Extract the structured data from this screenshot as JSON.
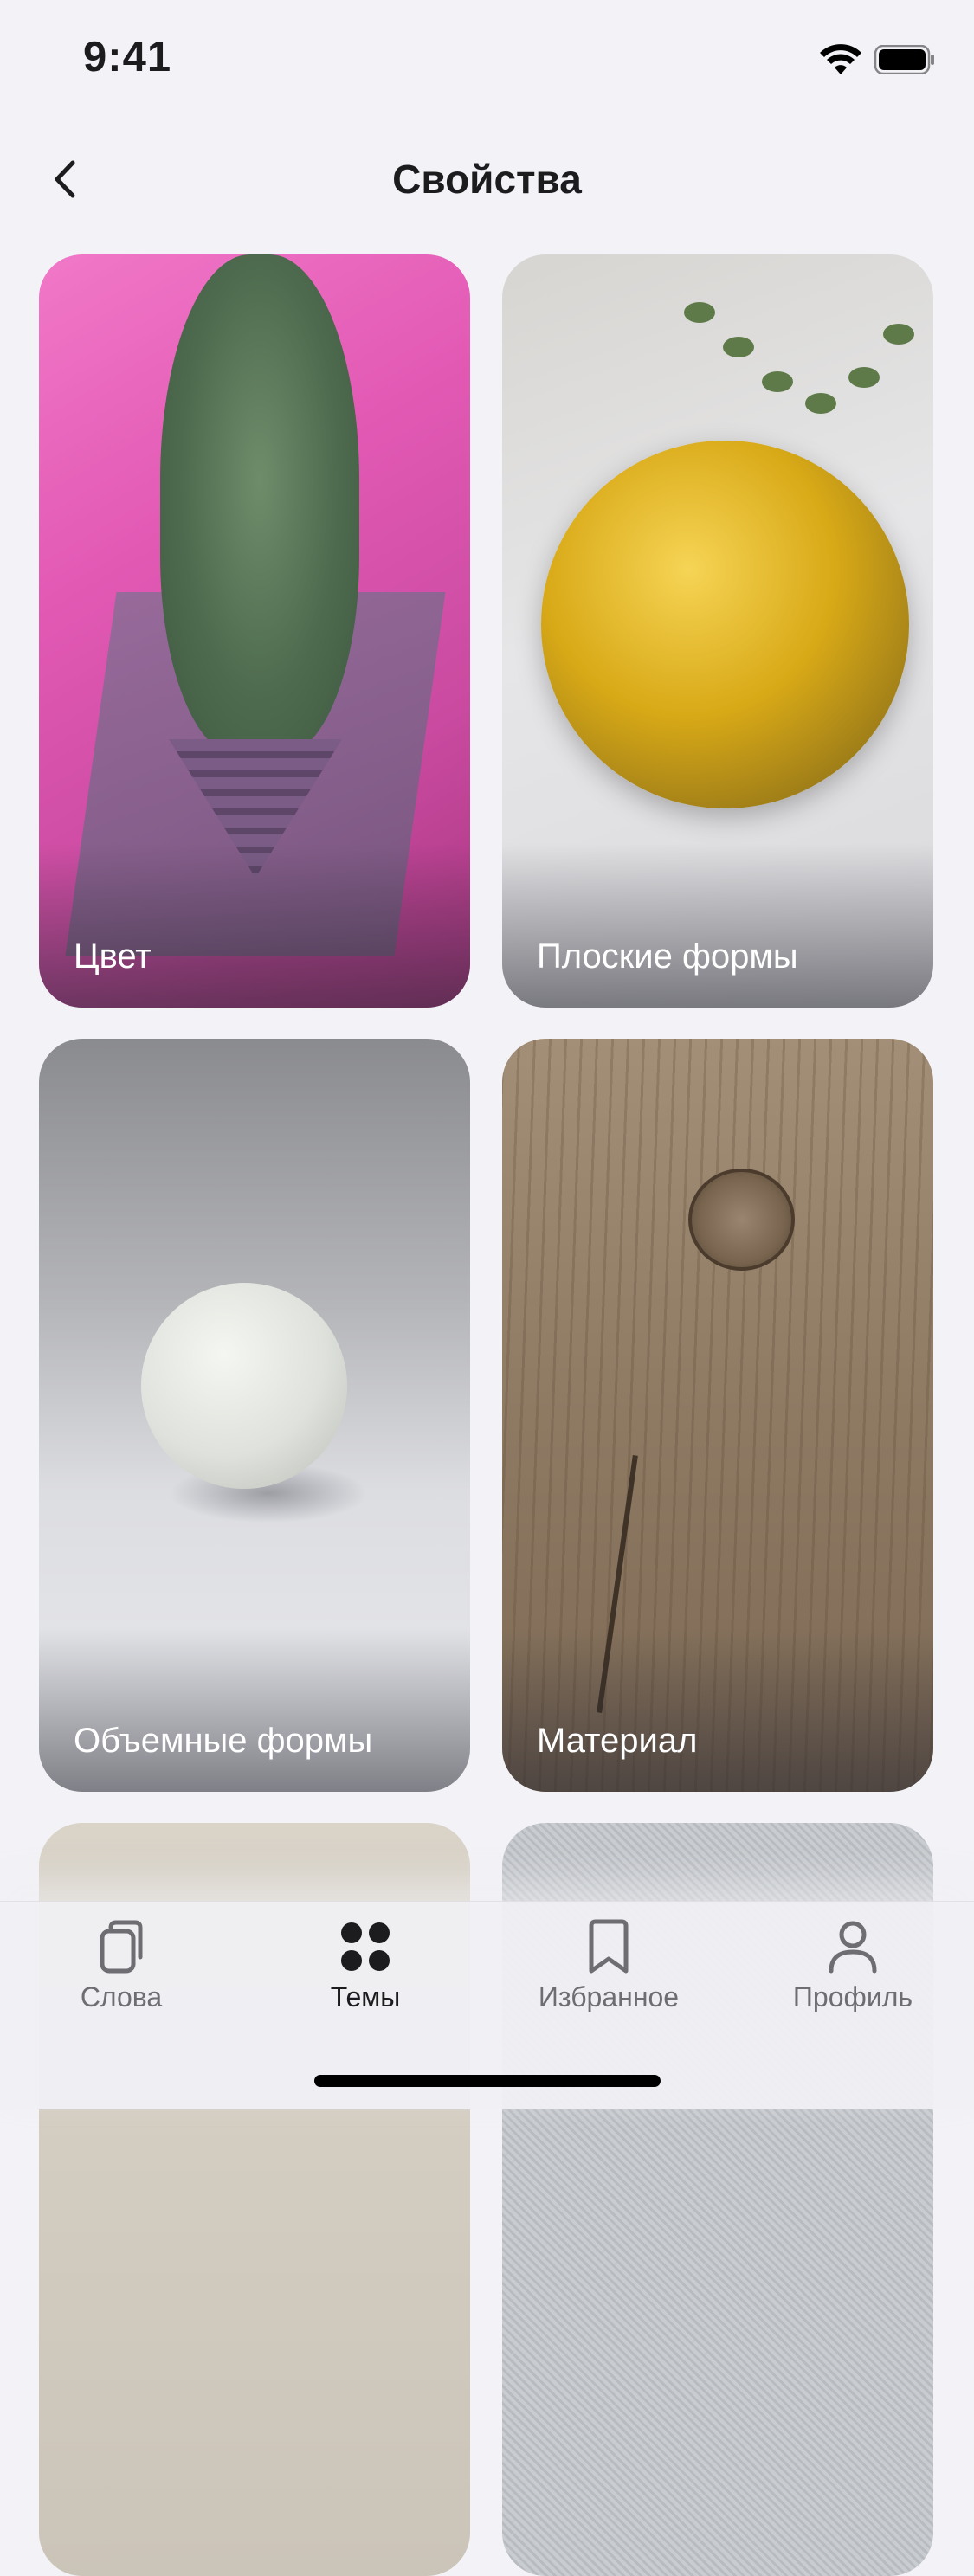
{
  "status_bar": {
    "time": "9:41",
    "icons": [
      "wifi-icon",
      "battery-icon"
    ]
  },
  "nav": {
    "back_icon": "chevron-left-icon",
    "title": "Свойства"
  },
  "cards": [
    {
      "label": "Цвет"
    },
    {
      "label": "Плоские формы"
    },
    {
      "label": "Объемные формы"
    },
    {
      "label": "Материал"
    },
    {
      "label": ""
    },
    {
      "label": ""
    }
  ],
  "tabs": [
    {
      "label": "Слова",
      "icon": "cards-icon",
      "active": false
    },
    {
      "label": "Темы",
      "icon": "grid-dots-icon",
      "active": true
    },
    {
      "label": "Избранное",
      "icon": "bookmark-icon",
      "active": false
    },
    {
      "label": "Профиль",
      "icon": "profile-icon",
      "active": false
    }
  ],
  "colors": {
    "background": "#f2f2f7",
    "text": "#1c1c1e",
    "tab_inactive": "#6d6d72",
    "card_label": "#ffffff"
  }
}
